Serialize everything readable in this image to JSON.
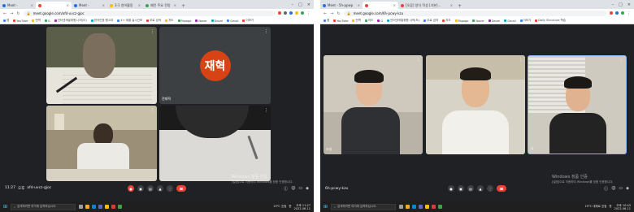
{
  "left": {
    "tabs": [
      {
        "label": "Meet - ",
        "color": "#1a73e8",
        "active": false
      },
      {
        "label": "",
        "color": "#ea4335",
        "active": true
      },
      {
        "label": "Meet - ",
        "color": "#1a73e8",
        "active": false
      },
      {
        "label": "3-1 영어활동",
        "color": "#fbbc04",
        "active": false
      },
      {
        "label": "패턴 주요 전망",
        "color": "#34a853",
        "active": false
      }
    ],
    "url": "meet.google.com/afd-uvcz-gjoc",
    "bookmarks": [
      "앱",
      "YouTube",
      "번역",
      "G",
      "인터넷개발위원 나의(도)",
      "한국인증 원고지",
      "4+·계열 실시간보",
      "무료 검색",
      "지도",
      "Papago",
      "Naver",
      "Daum",
      "Gmail",
      "더보기"
    ],
    "tiles": [
      {
        "name": "",
        "initials": ""
      },
      {
        "name": "전재혁",
        "initials": "재혁"
      },
      {
        "name": "",
        "initials": ""
      },
      {
        "name": "",
        "initials": ""
      }
    ],
    "meeting_time": "11:27",
    "meeting_sep": "오후",
    "meeting_code": "afd-uvcz-gjoc",
    "activate_title": "Windows 정품 인증",
    "activate_sub": "[설정]으로 이동하여 Windows를 정품 인증합니다.",
    "search_placeholder": "검색하려면 여기에 입력하십시오.",
    "weather": "19°C 흐림",
    "lang": "한",
    "time": "오후 11:27",
    "date": "2022-06-11"
  },
  "right": {
    "tabs": [
      {
        "label": "Meet - 5h-ppwp",
        "color": "#1a73e8",
        "active": false
      },
      {
        "label": "",
        "color": "#ea4335",
        "active": true
      },
      {
        "label": "[오류] 양식 작성 [기본]...",
        "color": "#ea4335",
        "active": false
      }
    ],
    "url": "meet.google.com/6h-pcwy-kzu",
    "bookmarks": [
      "앱",
      "YouTube",
      "번역",
      "지도",
      "G",
      "인터넷개발위원 나의(도)",
      "무료 검색",
      "지도",
      "Papago",
      "Naver",
      "Daum",
      "Gmail",
      "더보기",
      "Daily Structure 학습"
    ],
    "tiles": [
      {
        "name": "조성",
        "initials": ""
      },
      {
        "name": "",
        "initials": ""
      },
      {
        "name": "나",
        "initials": ""
      }
    ],
    "meeting_code": "6h-pcwy-kzu",
    "activate_title": "Windows 정품 인증",
    "activate_sub": "[설정]으로 이동하여 Windows를 정품 인증합니다.",
    "search_placeholder": "검색하려면 여기에 입력하십시오.",
    "weather": "19°C 대체로 흐림",
    "lang": "한",
    "time": "오후 10:43",
    "date": "2022-06-11"
  },
  "colors": {
    "meet_bg": "#202124",
    "end_call": "#ea4335",
    "avatar": "#d84315",
    "taskbar": "#1f1f1f",
    "active_border": "#8ab4f8"
  },
  "icons": [
    "back-icon",
    "forward-icon",
    "reload-icon",
    "lock-icon",
    "star-icon",
    "mic-icon",
    "camera-icon",
    "captions-icon",
    "present-icon",
    "more-icon",
    "end-call-icon",
    "info-icon",
    "people-icon",
    "chat-icon",
    "activities-icon",
    "windows-icon",
    "search-icon"
  ]
}
